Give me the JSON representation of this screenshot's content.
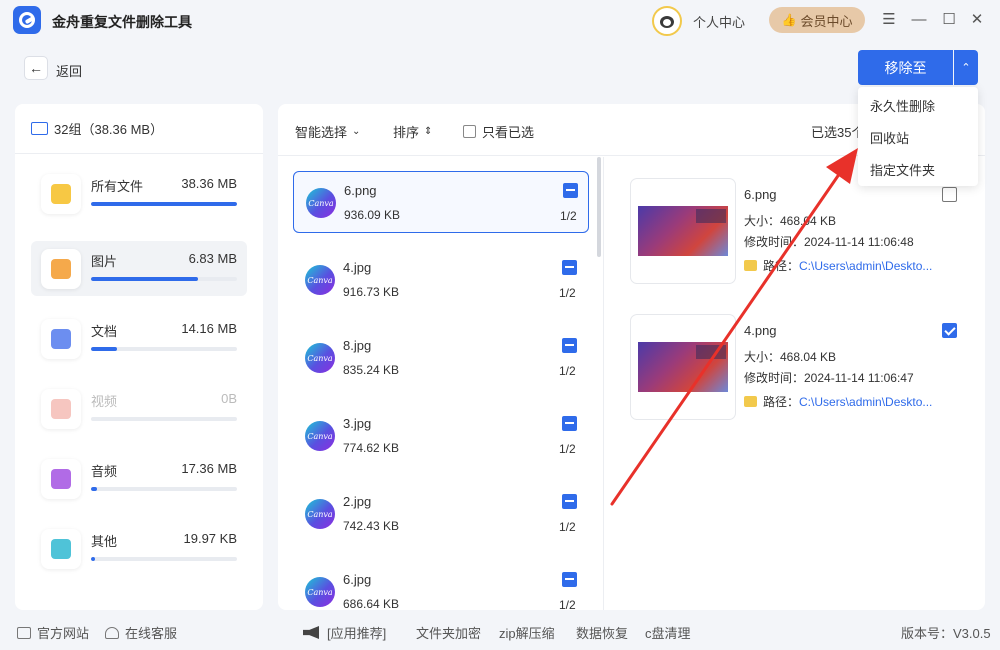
{
  "app": {
    "title": "金舟重复文件删除工具",
    "personal_center": "个人中心",
    "vip_center": "会员中心"
  },
  "window_controls": {
    "menu": "☰",
    "minimize": "—",
    "maximize": "☐",
    "close": "✕"
  },
  "nav": {
    "back_label": "返回",
    "back_arrow": "←"
  },
  "action": {
    "move_to_label": "移除至",
    "caret": "⌃"
  },
  "dropdown": {
    "items": [
      "永久性删除",
      "回收站",
      "指定文件夹"
    ]
  },
  "left_panel": {
    "group_summary": "32组（38.36 MB）",
    "categories": [
      {
        "name": "所有文件",
        "size": "38.36 MB",
        "fill": 1.0,
        "icon": "folder-icon",
        "color": "#f7c844"
      },
      {
        "name": "图片",
        "size": "6.83 MB",
        "fill": 0.73,
        "icon": "image-icon",
        "color": "#f5a94b"
      },
      {
        "name": "文档",
        "size": "14.16 MB",
        "fill": 0.18,
        "icon": "document-icon",
        "color": "#6c8ef0"
      },
      {
        "name": "视频",
        "size": "0B",
        "fill": 0,
        "icon": "video-icon",
        "color": "#f6c6c0"
      },
      {
        "name": "音频",
        "size": "17.36 MB",
        "fill": 0.04,
        "icon": "audio-icon",
        "color": "#b16be6"
      },
      {
        "name": "其他",
        "size": "19.97 KB",
        "fill": 0.03,
        "icon": "grid-icon",
        "color": "#4fc3d8"
      }
    ]
  },
  "toolbar": {
    "smart_select": "智能选择",
    "sort": "排序",
    "only_selected": "只看已选",
    "selected_count": "已选35个"
  },
  "files": [
    {
      "name": "6.png",
      "size": "936.09 KB",
      "count": "1/2",
      "logo": "Canva"
    },
    {
      "name": "4.jpg",
      "size": "916.73 KB",
      "count": "1/2",
      "logo": "Canva"
    },
    {
      "name": "8.jpg",
      "size": "835.24 KB",
      "count": "1/2",
      "logo": "Canva"
    },
    {
      "name": "3.jpg",
      "size": "774.62 KB",
      "count": "1/2",
      "logo": "Canva"
    },
    {
      "name": "2.jpg",
      "size": "742.43 KB",
      "count": "1/2",
      "logo": "Canva"
    },
    {
      "name": "6.jpg",
      "size": "686.64 KB",
      "count": "1/2",
      "logo": "Canva"
    }
  ],
  "details": [
    {
      "name": "6.png",
      "size": "大小：468.04 KB",
      "mtime": "修改时间：2024-11-14 11:06:48",
      "path_label": "路径：",
      "path": "C:\\Users\\admin\\Deskto...",
      "checked": false
    },
    {
      "name": "4.png",
      "size": "大小：468.04 KB",
      "mtime": "修改时间：2024-11-14 11:06:47",
      "path_label": "路径：",
      "path": "C:\\Users\\admin\\Deskto...",
      "checked": true
    }
  ],
  "footer": {
    "website": "官方网站",
    "support": "在线客服",
    "recommend": "[应用推荐]",
    "links": [
      "文件夹加密",
      "zip解压缩",
      "数据恢复",
      "c盘清理"
    ],
    "version": "版本号：V3.0.5"
  },
  "colors": {
    "accent": "#2f6bea",
    "vip": "#e7c9a8",
    "arrow": "#e8312a"
  }
}
